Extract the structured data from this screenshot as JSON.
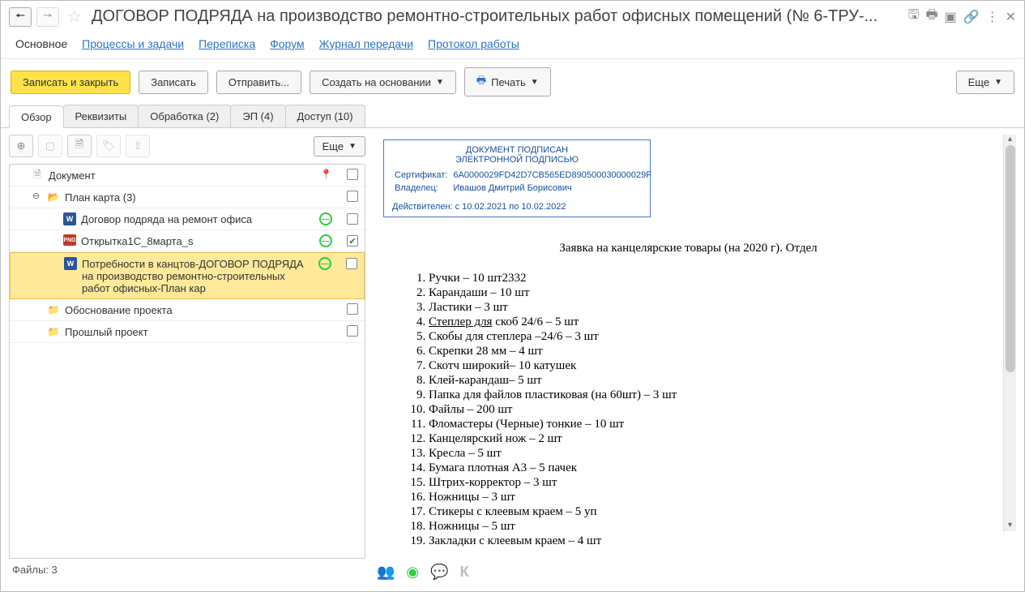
{
  "header": {
    "title": "ДОГОВОР ПОДРЯДА на производство ремонтно-строительных работ офисных помещений (№ 6-ТРУ-..."
  },
  "top_tabs": {
    "main": "Основное",
    "processes": "Процессы и задачи",
    "correspondence": "Переписка",
    "forum": "Форум",
    "transfer_log": "Журнал передачи",
    "work_protocol": "Протокол работы"
  },
  "toolbar": {
    "save_close": "Записать и закрыть",
    "save": "Записать",
    "send": "Отправить...",
    "create_based": "Создать на основании",
    "print": "Печать",
    "more": "Еще"
  },
  "sub_tabs": {
    "overview": "Обзор",
    "details": "Реквизиты",
    "processing": "Обработка (2)",
    "ep": "ЭП (4)",
    "access": "Доступ (10)"
  },
  "tree_toolbar": {
    "more": "Еще"
  },
  "tree": {
    "root": "Документ",
    "plan_map": "План карта (3)",
    "contract": "Договор подряда на ремонт офиса",
    "postcard": "Открытка1С_8марта_s",
    "needs": "Потребности в канцтов-ДОГОВОР ПОДРЯДА на производство ремонтно-строительных работ офисных-План кар",
    "justification": "Обоснование проекта",
    "previous": "Прошлый проект"
  },
  "files_label": "Файлы:  3",
  "stamp": {
    "line1": "ДОКУМЕНТ ПОДПИСАН",
    "line2": "ЭЛЕКТРОННОЙ ПОДПИСЬЮ",
    "cert_label": "Сертификат:",
    "cert_val": "6A0000029FD42D7CB565ED890500030000029F",
    "owner_label": "Владелец:",
    "owner_val": "Ивашов Дмитрий Борисович",
    "valid": "Действителен: с 10.02.2021 по 10.02.2022"
  },
  "doc": {
    "title": "Заявка на канцелярские товары (на 2020 г). Отдел",
    "items": [
      "Ручки – 10 шт2332",
      "Карандаши – 10 шт",
      "Ластики – 3 шт",
      "<span class='ul'>Степлер для</span> скоб 24/6 – 5 шт",
      "Скобы для степлера –24/6 – 3 шт",
      "Скрепки 28 мм – 4 шт",
      "Скотч широкий– 10 катушек",
      "Клей-карандаш– 5 шт",
      "Папка для файлов пластиковая (на 60шт) – 3 шт",
      "Файлы – 200 шт",
      "Фломастеры (Черные) тонкие – 10 шт",
      "Канцелярский нож – 2 шт",
      "Кресла – 5 шт",
      "Бумага плотная А3 – 5 пачек",
      "Штрих-корректор – 3 шт",
      "Ножницы – 3 шт",
      "Стикеры с клеевым краем – 5 уп",
      "Ножницы – 5 шт",
      "Закладки с клеевым краем – 4 шт"
    ]
  }
}
